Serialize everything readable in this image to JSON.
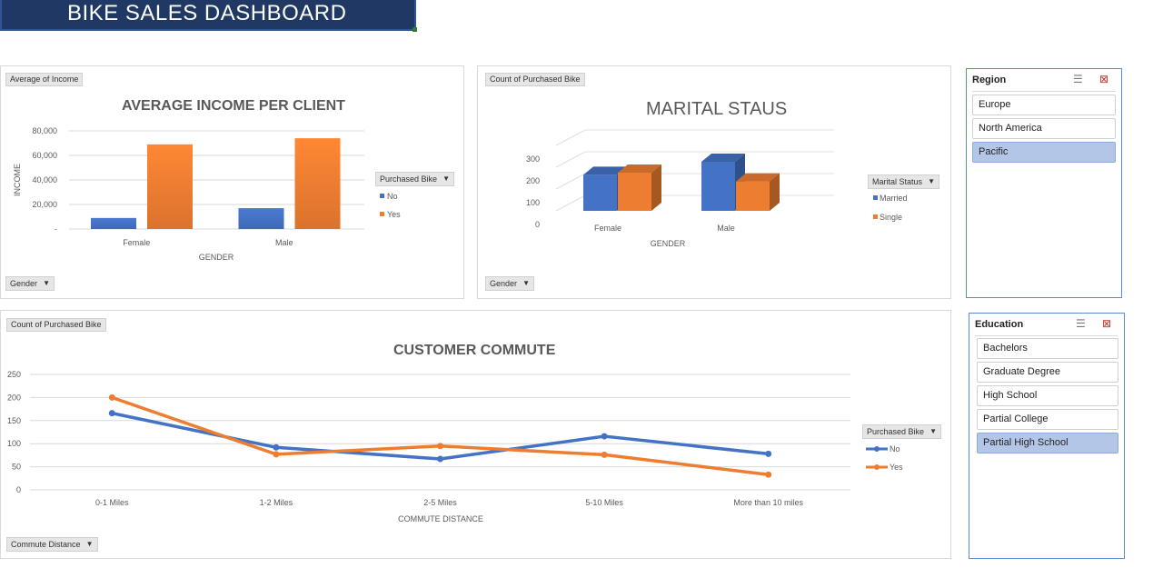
{
  "title": "BIKE SALES DASHBOARD",
  "colors": {
    "blue": "#4472c4",
    "orange": "#ed7d31",
    "banner": "#1f3864"
  },
  "income_chart": {
    "value_button": "Average of Income",
    "axis_button": "Gender",
    "title": "AVERAGE INCOME PER CLIENT",
    "legend_button": "Purchased Bike",
    "legend": [
      "No",
      "Yes"
    ],
    "y_tick_labels": [
      "80,000",
      "60,000",
      "40,000",
      "20,000",
      "-"
    ],
    "x_tick_labels": [
      "Female",
      "Male"
    ],
    "xlabel": "GENDER",
    "ylabel": "INCOME"
  },
  "marital_chart": {
    "value_button": "Count of Purchased Bike",
    "axis_button": "Gender",
    "title": "MARITAL STAUS",
    "legend_button": "Marital Status",
    "legend": [
      "Married",
      "Single"
    ],
    "y_tick_labels": [
      "300",
      "200",
      "100",
      "0"
    ],
    "x_tick_labels": [
      "Female",
      "Male"
    ],
    "xlabel": "GENDER"
  },
  "commute_chart": {
    "value_button": "Count of Purchased Bike",
    "axis_button": "Commute Distance",
    "title": "CUSTOMER COMMUTE",
    "legend_button": "Purchased Bike",
    "legend": [
      "No",
      "Yes"
    ],
    "y_tick_labels": [
      "250",
      "200",
      "150",
      "100",
      "50",
      "0"
    ],
    "x_tick_labels": [
      "0-1 Miles",
      "1-2 Miles",
      "2-5 Miles",
      "5-10 Miles",
      "More than 10 miles"
    ],
    "xlabel": "COMMUTE DISTANCE"
  },
  "chart_data": [
    {
      "type": "bar",
      "title": "AVERAGE INCOME PER CLIENT",
      "xlabel": "GENDER",
      "ylabel": "INCOME",
      "categories": [
        "Female",
        "Male"
      ],
      "ylim": [
        0,
        80000
      ],
      "series": [
        {
          "name": "No",
          "values": [
            9000,
            17000
          ]
        },
        {
          "name": "Yes",
          "values": [
            69000,
            74000
          ]
        }
      ]
    },
    {
      "type": "bar",
      "title": "MARITAL STAUS",
      "xlabel": "GENDER",
      "categories": [
        "Female",
        "Male"
      ],
      "ylim": [
        0,
        300
      ],
      "series": [
        {
          "name": "Married",
          "values": [
            240,
            300
          ]
        },
        {
          "name": "Single",
          "values": [
            250,
            210
          ]
        }
      ]
    },
    {
      "type": "line",
      "title": "CUSTOMER COMMUTE",
      "xlabel": "COMMUTE DISTANCE",
      "categories": [
        "0-1 Miles",
        "1-2 Miles",
        "2-5 Miles",
        "5-10 Miles",
        "More than 10 miles"
      ],
      "ylim": [
        0,
        250
      ],
      "series": [
        {
          "name": "No",
          "values": [
            166,
            92,
            67,
            116,
            78
          ]
        },
        {
          "name": "Yes",
          "values": [
            200,
            77,
            95,
            76,
            33
          ]
        }
      ]
    }
  ],
  "region_slicer": {
    "header": "Region",
    "items": [
      {
        "label": "Europe",
        "selected": false
      },
      {
        "label": "North America",
        "selected": false
      },
      {
        "label": "Pacific",
        "selected": true
      }
    ],
    "icons": [
      "multi-select-icon",
      "clear-filter-icon"
    ]
  },
  "education_slicer": {
    "header": "Education",
    "items": [
      {
        "label": "Bachelors",
        "selected": false
      },
      {
        "label": "Graduate Degree",
        "selected": false
      },
      {
        "label": "High School",
        "selected": false
      },
      {
        "label": "Partial College",
        "selected": false
      },
      {
        "label": "Partial High School",
        "selected": true
      }
    ],
    "icons": [
      "multi-select-icon",
      "clear-filter-icon"
    ]
  }
}
